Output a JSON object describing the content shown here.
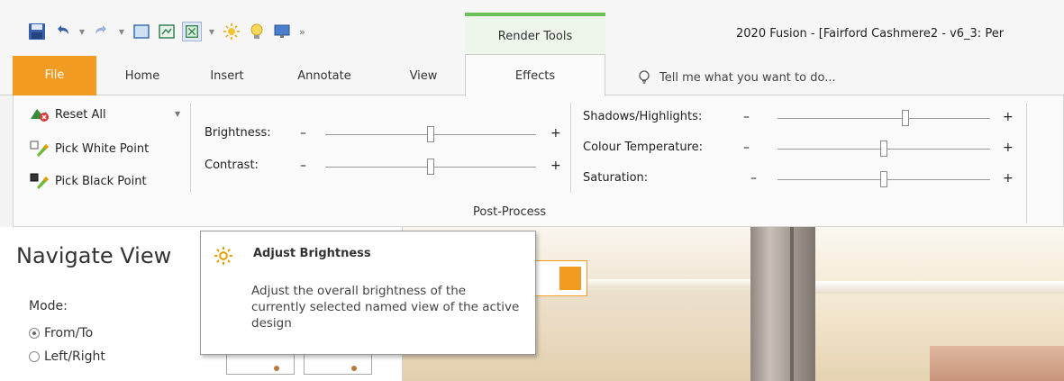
{
  "window": {
    "title": "2020 Fusion - [Fairford Cashmere2 - v6_3: Per",
    "context_tab": "Render Tools"
  },
  "quick_access": {
    "icons": [
      "save-icon",
      "undo-icon",
      "redo-icon",
      "view-icon",
      "image-icon",
      "fit-icon",
      "brightness-icon",
      "lightbulb-icon",
      "monitor-icon"
    ],
    "more": "»"
  },
  "tabs": [
    {
      "label": "File"
    },
    {
      "label": "Home"
    },
    {
      "label": "Insert"
    },
    {
      "label": "Annotate"
    },
    {
      "label": "View"
    },
    {
      "label": "Effects"
    }
  ],
  "tell_me": "Tell me what you want to do...",
  "ribbon": {
    "reset_all": "Reset All",
    "pick_white": "Pick White Point",
    "pick_black": "Pick Black Point",
    "brightness": {
      "label": "Brightness:",
      "value": 0.5
    },
    "contrast": {
      "label": "Contrast:",
      "value": 0.5
    },
    "shadows": {
      "label": "Shadows/Highlights:",
      "value": 0.6
    },
    "colour_temp": {
      "label": "Colour Temperature:",
      "value": 0.5
    },
    "saturation": {
      "label": "Saturation:",
      "value": 0.5
    },
    "minus": "–",
    "plus": "+",
    "group_label": "Post-Process"
  },
  "navigate": {
    "title": "Navigate View",
    "mode_label": "Mode:",
    "option_from_to": "From/To",
    "option_left_right": "Left/Right",
    "selected": "From/To"
  },
  "tooltip": {
    "title": "Adjust Brightness",
    "body": "Adjust the overall brightness of the currently selected named view of the active design"
  },
  "colors": {
    "file_tab": "#f29b22",
    "context_tab_accent": "#6cbf59"
  }
}
